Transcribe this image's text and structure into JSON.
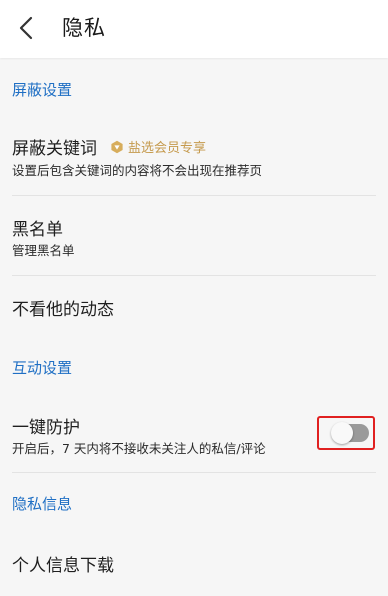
{
  "header": {
    "title": "隐私",
    "back_icon": "chevron-left-icon"
  },
  "sections": {
    "block": {
      "label": "屏蔽设置"
    },
    "interaction": {
      "label": "互动设置"
    },
    "privacy_info": {
      "label": "隐私信息"
    }
  },
  "items": {
    "keywords": {
      "title": "屏蔽关键词",
      "badge": "盐选会员专享",
      "badge_icon": "vip-diamond-icon",
      "subtitle": "设置后包含关键词的内容将不会出现在推荐页"
    },
    "blacklist": {
      "title": "黑名单",
      "subtitle": "管理黑名单"
    },
    "hide_activity": {
      "title": "不看他的动态"
    },
    "one_click_protect": {
      "title": "一键防护",
      "subtitle": "开启后，7 天内将不接收未关注人的私信/评论",
      "enabled": false
    },
    "download_info": {
      "title": "个人信息下载"
    }
  },
  "colors": {
    "section_header": "#1f6fc4",
    "badge": "#c59a4d",
    "highlight": "#e02020",
    "toggle_off": "#9a9a9a"
  }
}
